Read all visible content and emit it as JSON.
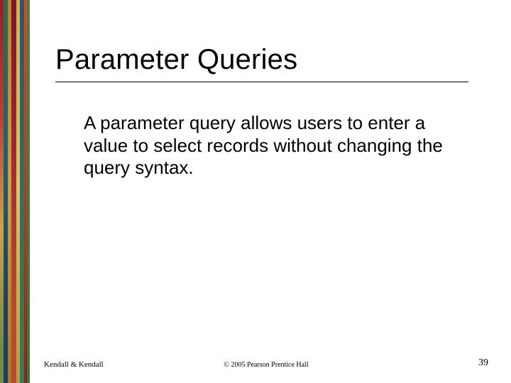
{
  "slide": {
    "title": "Parameter Queries",
    "body": "A parameter query allows users to enter a value to select records without changing the query syntax."
  },
  "footer": {
    "left": "Kendall & Kendall",
    "center": "© 2005 Pearson Prentice Hall",
    "page": "39"
  }
}
